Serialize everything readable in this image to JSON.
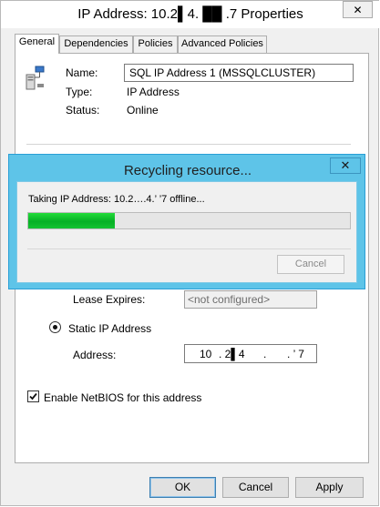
{
  "window": {
    "title": "IP Address: 10.2▌4.  ██  .7 Properties",
    "close_glyph": "✕"
  },
  "tabs": [
    {
      "label": "General",
      "active": true
    },
    {
      "label": "Dependencies",
      "active": false
    },
    {
      "label": "Policies",
      "active": false
    },
    {
      "label": "Advanced Policies",
      "active": false
    }
  ],
  "resource": {
    "icon": "server-network-icon",
    "name_label": "Name:",
    "name_value": "SQL IP Address 1 (MSSQLCLUSTER)",
    "type_label": "Type:",
    "type_value": "IP Address",
    "status_label": "Status:",
    "status_value": "Online"
  },
  "lease": {
    "label": "Lease Expires:",
    "value": "<not configured>"
  },
  "static_ip": {
    "label": "Static IP Address",
    "selected": true,
    "address_label": "Address:",
    "octets": [
      "10",
      ". 2▌4",
      ".",
      ". ’ 7"
    ]
  },
  "netbios": {
    "label": "Enable NetBIOS for this address",
    "checked": true
  },
  "buttons": {
    "ok": "OK",
    "cancel": "Cancel",
    "apply": "Apply"
  },
  "dialog": {
    "title": "Recycling resource...",
    "close_glyph": "✕",
    "message": "Taking IP Address: 10.2….4.’     ’7 offline...",
    "progress": 0.27,
    "cancel_label": "Cancel",
    "accent": "#5ec4e8",
    "progress_color": "#06b025"
  }
}
